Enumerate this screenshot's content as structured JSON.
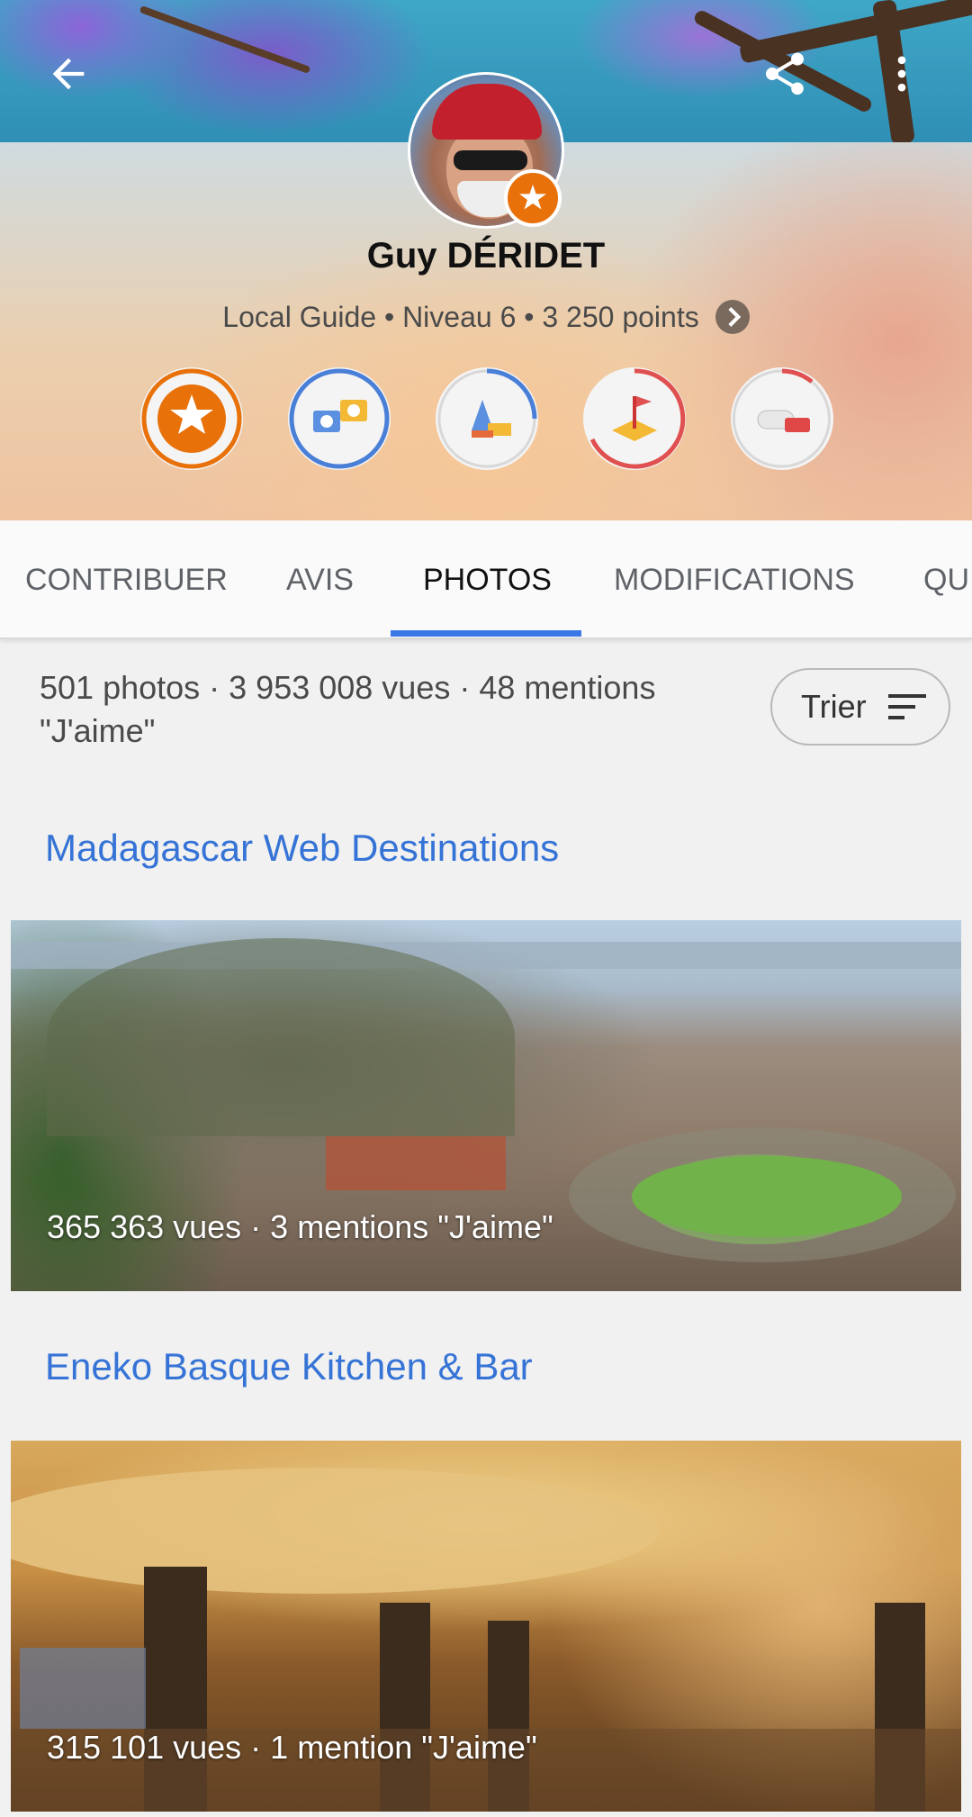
{
  "header": {
    "back_icon": "arrow-left-icon",
    "share_icon": "share-icon",
    "more_icon": "more-vert-icon"
  },
  "profile": {
    "name": "Guy DÉRIDET",
    "level_line": "Local Guide • Niveau 6 • 3 250 points",
    "badges": [
      "local-guide-star-badge",
      "photographer-badge",
      "reviewer-badge",
      "places-added-badge",
      "fact-checker-badge"
    ]
  },
  "tabs": [
    {
      "label": "CONTRIBUER",
      "active": false
    },
    {
      "label": "AVIS",
      "active": false
    },
    {
      "label": "PHOTOS",
      "active": true
    },
    {
      "label": "MODIFICATIONS",
      "active": false
    },
    {
      "label": "QU",
      "active": false
    }
  ],
  "summary": {
    "stats": "501 photos · 3 953 008 vues · 48 mentions \"J'aime\"",
    "sort_label": "Trier"
  },
  "places": [
    {
      "title": "Madagascar Web Destinations",
      "caption": "365 363 vues · 3 mentions \"J'aime\""
    },
    {
      "title": "Eneko Basque Kitchen & Bar",
      "caption": "315 101 vues · 1 mention \"J'aime\""
    }
  ],
  "colors": {
    "accent_blue": "#3b78e7",
    "link_blue": "#3573d6",
    "local_guide_orange": "#e8710a"
  }
}
